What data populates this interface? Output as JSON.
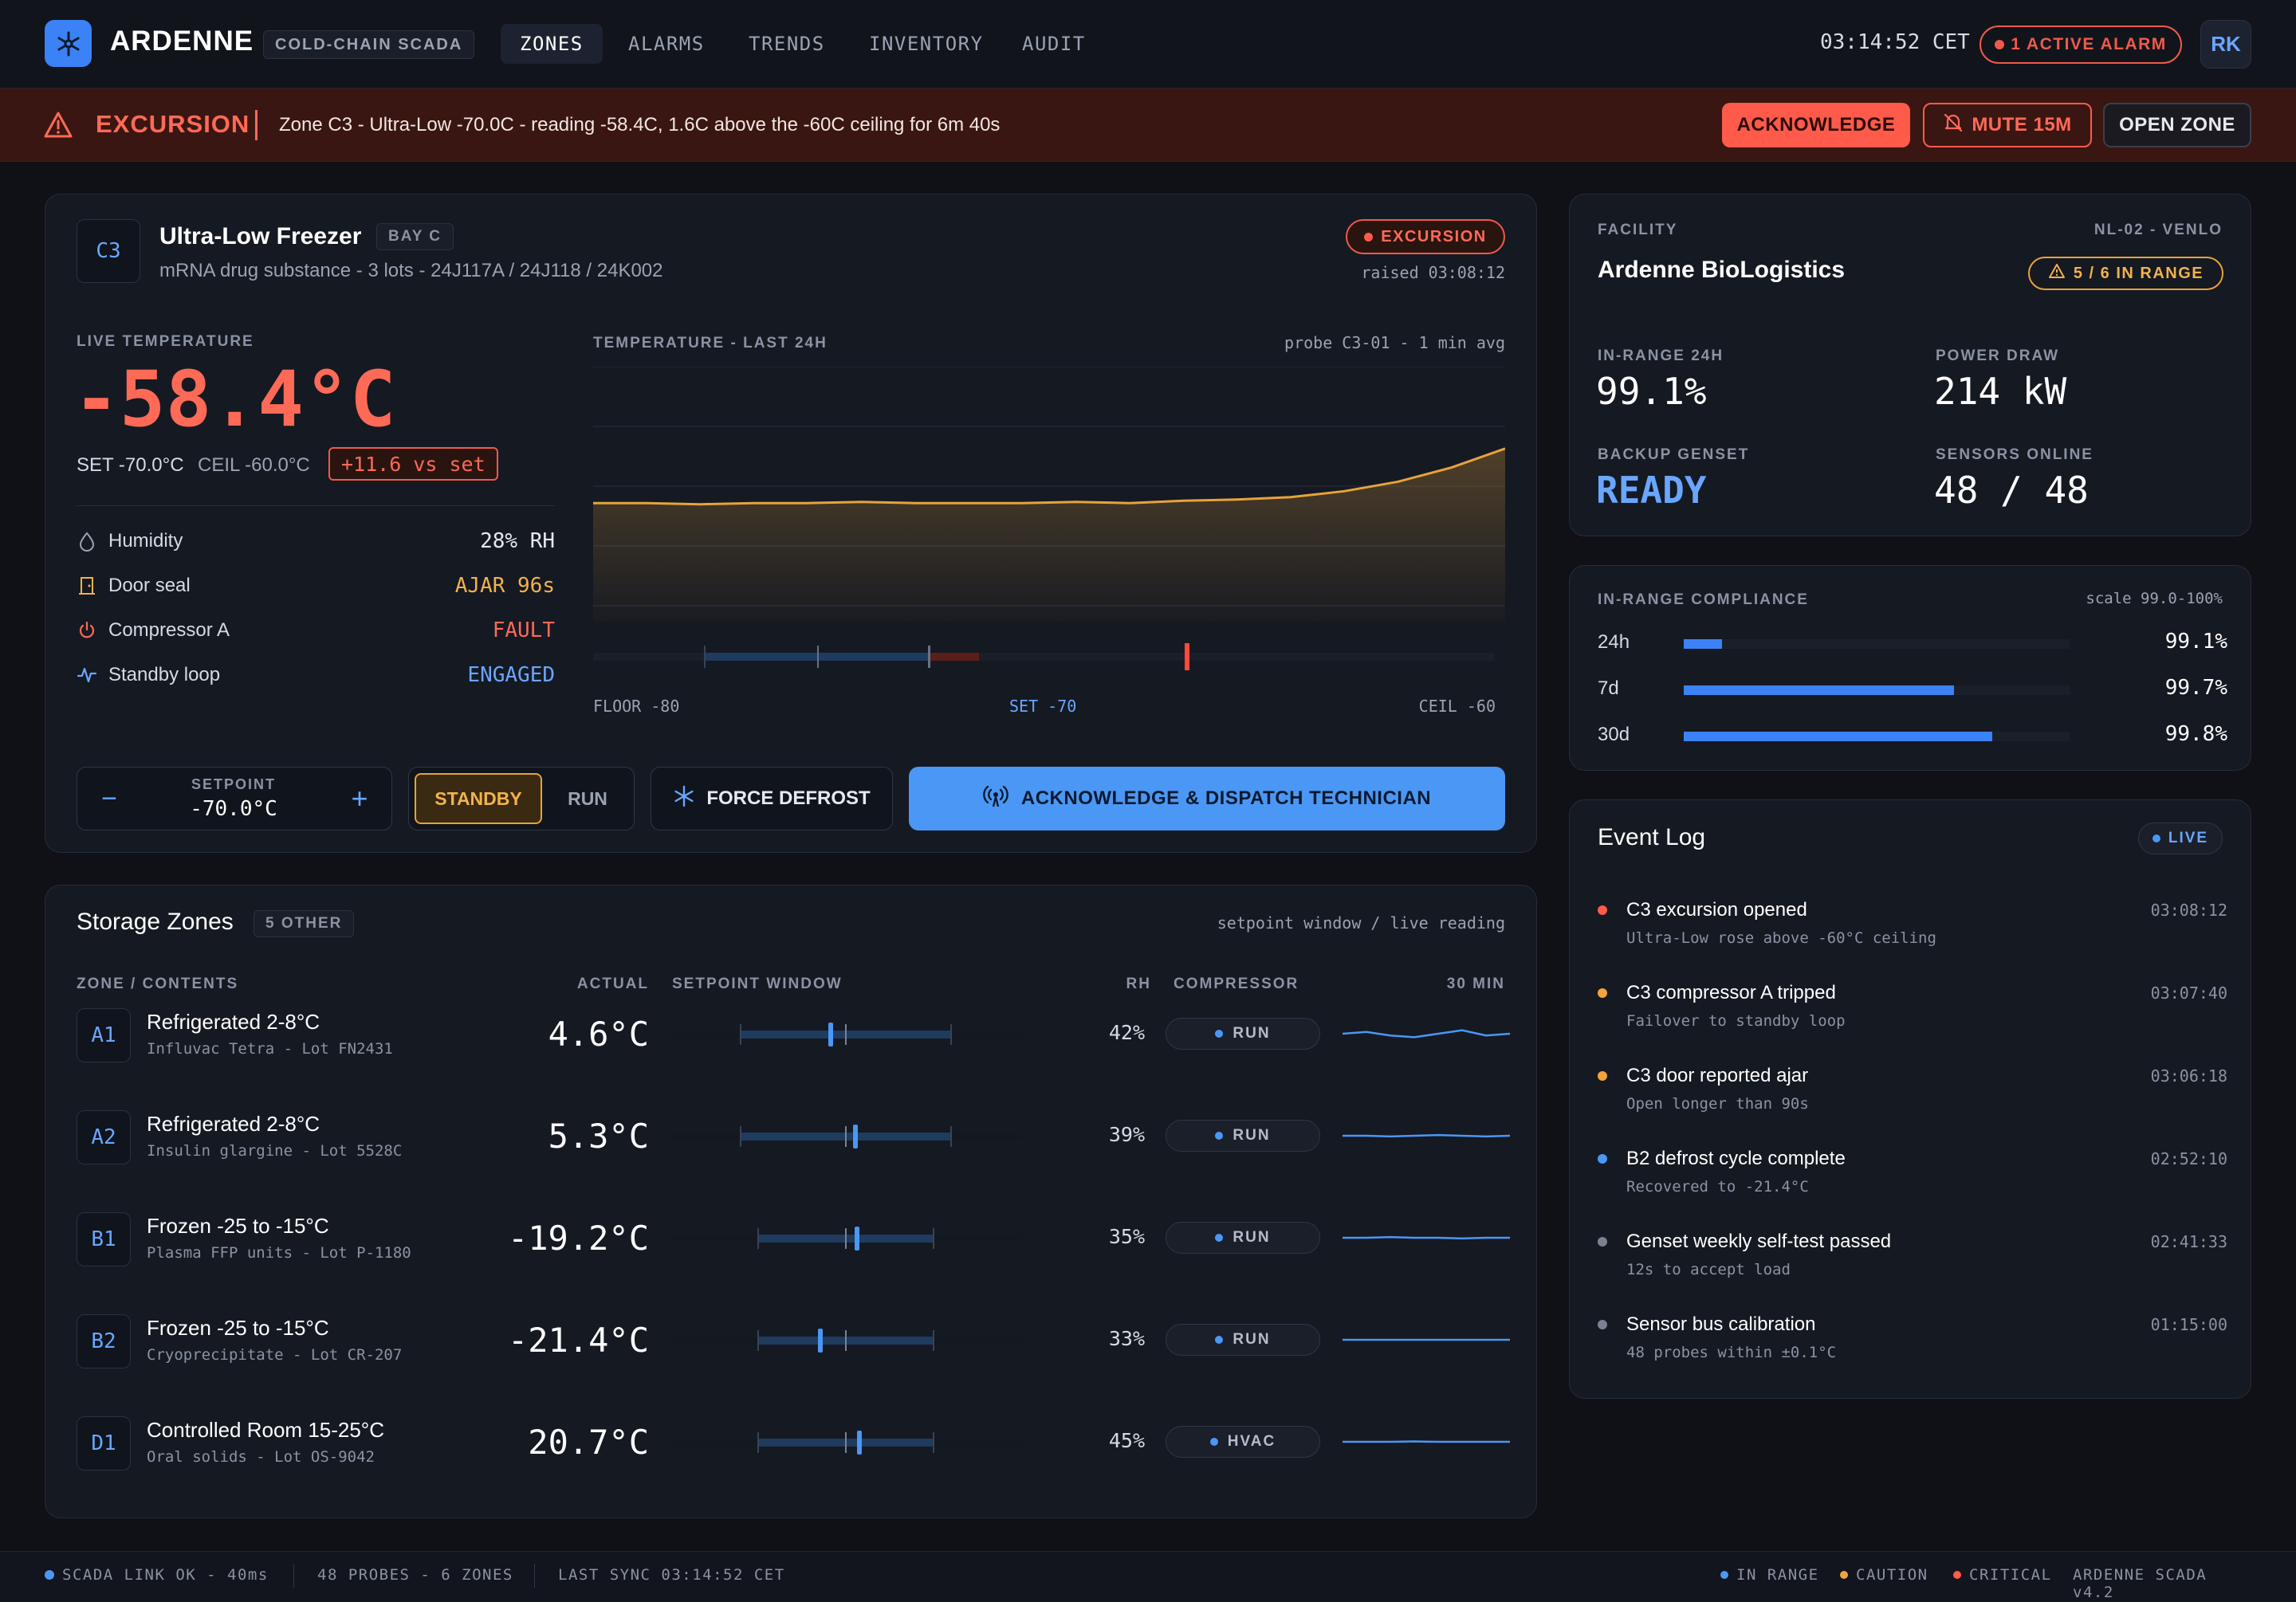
{
  "app": {
    "brand": "ARDENNE",
    "tag": "COLD-CHAIN SCADA",
    "nav": [
      {
        "label": "ZONES",
        "active": true
      },
      {
        "label": "ALARMS",
        "active": false
      },
      {
        "label": "TRENDS",
        "active": false
      },
      {
        "label": "INVENTORY",
        "active": false
      },
      {
        "label": "AUDIT",
        "active": false
      }
    ],
    "clock": "03:14:52 CET",
    "alarm_pill": "1 ACTIVE ALARM",
    "avatar": "RK"
  },
  "excursion": {
    "title": "EXCURSION",
    "message": "Zone C3 - Ultra-Low -70.0C - reading -58.4C, 1.6C above the -60C ceiling for 6m 40s",
    "ack": "ACKNOWLEDGE",
    "mute": "MUTE 15M",
    "open": "OPEN ZONE"
  },
  "zone": {
    "code": "C3",
    "name": "Ultra-Low Freezer",
    "bay": "BAY C",
    "contents": "mRNA drug substance - 3 lots - 24J117A / 24J118 / 24K002",
    "status": "EXCURSION",
    "raised": "raised 03:08:12",
    "live_label": "LIVE TEMPERATURE",
    "live_temp": "-58.4°C",
    "set": "SET -70.0°C",
    "ceil": "CEIL -60.0°C",
    "delta": "+11.6 vs set",
    "stats": [
      {
        "icon": "droplet-icon",
        "label": "Humidity",
        "value": "28% RH",
        "color": "#e6e9ef"
      },
      {
        "icon": "door-icon",
        "label": "Door seal",
        "value": "AJAR 96s",
        "color": "#f2b24d"
      },
      {
        "icon": "power-icon",
        "label": "Compressor A",
        "value": "FAULT",
        "color": "#ff6a57"
      },
      {
        "icon": "pulse-icon",
        "label": "Standby loop",
        "value": "ENGAGED",
        "color": "#6aa6ff"
      }
    ],
    "chart_title": "TEMPERATURE - LAST 24H",
    "chart_note": "probe C3-01 - 1 min avg",
    "scale": {
      "floor": "FLOOR -80",
      "set": "SET -70",
      "ceil": "CEIL -60"
    },
    "controls": {
      "setpoint_label": "SETPOINT",
      "setpoint_value": "-70.0°C",
      "minus": "−",
      "plus": "+",
      "standby": "STANDBY",
      "run": "RUN",
      "defrost": "FORCE DEFROST",
      "dispatch": "ACKNOWLEDGE & DISPATCH TECHNICIAN"
    }
  },
  "chart_data": {
    "type": "area",
    "title": "TEMPERATURE - LAST 24H",
    "series": [
      {
        "values": [
          -70.0,
          -70.0,
          -70.1,
          -70.0,
          -70.0,
          -69.9,
          -70.0,
          -70.0,
          -70.0,
          -69.9,
          -70.0,
          -69.8,
          -69.7,
          -69.5,
          -69.0,
          -68.2,
          -67.0,
          -65.4
        ]
      }
    ],
    "grid": true
  },
  "zones": {
    "title": "Storage Zones",
    "other": "5 OTHER",
    "note": "setpoint window / live reading",
    "headers": {
      "zone": "ZONE / CONTENTS",
      "actual": "ACTUAL",
      "window": "SETPOINT WINDOW",
      "rh": "RH",
      "compressor": "COMPRESSOR",
      "trend": "30 MIN"
    },
    "rows": [
      {
        "code": "A1",
        "name": "Refrigerated 2-8°C",
        "sub": "Influvac Tetra - Lot FN2431",
        "actual": "4.6°C",
        "rh": "42%",
        "comp": "RUN",
        "marker": 0.43,
        "trend": [
          0.5,
          0.55,
          0.45,
          0.4,
          0.5,
          0.6,
          0.45,
          0.5
        ]
      },
      {
        "code": "A2",
        "name": "Refrigerated 2-8°C",
        "sub": "Insulin glargine - Lot 5528C",
        "actual": "5.3°C",
        "rh": "39%",
        "comp": "RUN",
        "marker": 0.55,
        "trend": [
          0.5,
          0.5,
          0.48,
          0.5,
          0.52,
          0.5,
          0.48,
          0.5
        ]
      },
      {
        "code": "B1",
        "name": "Frozen -25 to -15°C",
        "sub": "Plasma FFP units - Lot P-1180",
        "actual": "-19.2°C",
        "rh": "35%",
        "comp": "RUN",
        "marker": 0.57,
        "trend": [
          0.5,
          0.5,
          0.52,
          0.5,
          0.5,
          0.48,
          0.5,
          0.5
        ]
      },
      {
        "code": "B2",
        "name": "Frozen -25 to -15°C",
        "sub": "Cryoprecipitate - Lot CR-207",
        "actual": "-21.4°C",
        "rh": "33%",
        "comp": "RUN",
        "marker": 0.36,
        "trend": [
          0.5,
          0.5,
          0.5,
          0.5,
          0.5,
          0.5,
          0.5,
          0.5
        ]
      },
      {
        "code": "D1",
        "name": "Controlled Room 15-25°C",
        "sub": "Oral solids - Lot OS-9042",
        "actual": "20.7°C",
        "rh": "45%",
        "comp": "HVAC",
        "marker": 0.58,
        "trend": [
          0.5,
          0.5,
          0.5,
          0.51,
          0.5,
          0.5,
          0.5,
          0.5
        ]
      }
    ]
  },
  "facility": {
    "label": "FACILITY",
    "site": "NL-02 - VENLO",
    "name": "Ardenne BioLogistics",
    "range_pill": "5 / 6 IN RANGE",
    "kpis": [
      {
        "label": "IN-RANGE 24H",
        "value": "99.1%",
        "color": "#ffffff"
      },
      {
        "label": "POWER DRAW",
        "value": "214 kW",
        "color": "#ffffff"
      },
      {
        "label": "BACKUP GENSET",
        "value": "READY",
        "color": "#6aa6ff"
      },
      {
        "label": "SENSORS ONLINE",
        "value": "48 / 48",
        "color": "#ffffff"
      }
    ]
  },
  "compliance": {
    "title": "IN-RANGE COMPLIANCE",
    "scale": "scale 99.0-100%",
    "rows": [
      {
        "k": "24h",
        "v": "99.1%",
        "pct": 99.1
      },
      {
        "k": "7d",
        "v": "99.7%",
        "pct": 99.7
      },
      {
        "k": "30d",
        "v": "99.8%",
        "pct": 99.8
      }
    ]
  },
  "log": {
    "title": "Event Log",
    "live": "LIVE",
    "events": [
      {
        "t": "C3 excursion opened",
        "s": "Ultra-Low rose above -60°C ceiling",
        "time": "03:08:12",
        "color": "#ff5a4a"
      },
      {
        "t": "C3 compressor A tripped",
        "s": "Failover to standby loop",
        "time": "03:07:40",
        "color": "#f2a43b"
      },
      {
        "t": "C3 door reported ajar",
        "s": "Open longer than 90s",
        "time": "03:06:18",
        "color": "#f2a43b"
      },
      {
        "t": "B2 defrost cycle complete",
        "s": "Recovered to -21.4°C",
        "time": "02:52:10",
        "color": "#4a97f5"
      },
      {
        "t": "Genset weekly self-test passed",
        "s": "12s to accept load",
        "time": "02:41:33",
        "color": "#7a8190"
      },
      {
        "t": "Sensor bus calibration",
        "s": "48 probes within ±0.1°C",
        "time": "01:15:00",
        "color": "#7a8190"
      }
    ]
  },
  "footer": {
    "link": "SCADA LINK OK - 40ms",
    "probes": "48 PROBES - 6 ZONES",
    "sync": "LAST SYNC 03:14:52 CET",
    "in_range": "IN RANGE",
    "caution": "CAUTION",
    "critical": "CRITICAL",
    "version": "ARDENNE SCADA v4.2"
  },
  "colors": {
    "accent": "#3b82f6",
    "critical": "#ff5a4a",
    "caution": "#f2a43b"
  }
}
